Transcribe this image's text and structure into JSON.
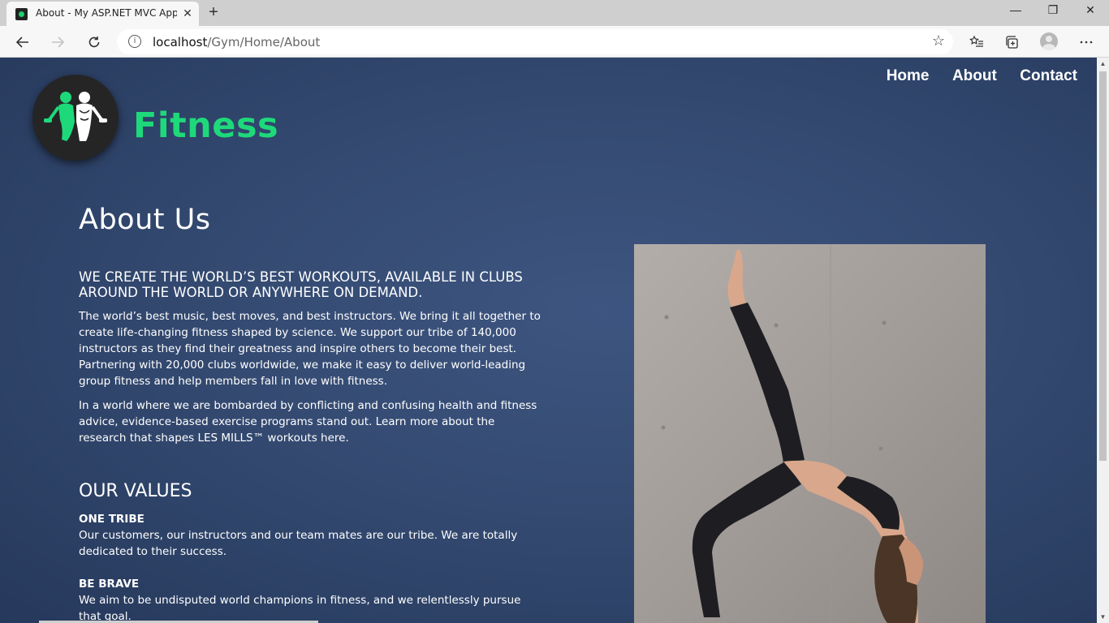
{
  "browser": {
    "tab_title": "About - My ASP.NET MVC Application",
    "tab_close": "✕",
    "new_tab": "+",
    "url_host": "localhost",
    "url_path": "/Gym/Home/About",
    "window_controls": {
      "minimize": "—",
      "restore": "❐",
      "close": "✕"
    },
    "icons": {
      "back": "back-arrow-icon",
      "forward": "forward-arrow-icon",
      "refresh": "refresh-icon",
      "info": "info-icon",
      "favorite": "star-icon",
      "favorites_bar": "favorites-icon",
      "collections": "collections-icon",
      "profile": "profile-avatar",
      "more": "ellipsis-icon"
    }
  },
  "site": {
    "brand": "Fitness",
    "brand_color": "#1ed97a",
    "nav": [
      "Home",
      "About",
      "Contact"
    ]
  },
  "main": {
    "heading": "About Us",
    "subheading": "WE CREATE THE WORLD’S BEST WORKOUTS, AVAILABLE IN CLUBS AROUND THE WORLD OR ANYWHERE ON DEMAND.",
    "paragraphs": [
      "The world’s best music, best moves, and best instructors. We bring it all together to create life-changing fitness shaped by science. We support our tribe of 140,000 instructors as they find their greatness and inspire others to become their best. Partnering with 20,000 clubs worldwide, we make it easy to deliver world-leading group fitness and help members fall in love with fitness.",
      "In a world where we are bombarded by conflicting and confusing health and fitness advice, evidence-based exercise programs stand out. Learn more about the research that shapes LES MILLS™ workouts here."
    ],
    "values_heading": "OUR VALUES",
    "values": [
      {
        "title": "ONE TRIBE",
        "text": "Our customers, our instructors and our team mates are our tribe. We are totally dedicated to their success."
      },
      {
        "title": "BE BRAVE",
        "text": "We aim to be undisputed world champions in fitness, and we relentlessly pursue that goal."
      }
    ]
  },
  "colors": {
    "page_bg": "#344a71",
    "text": "#ffffff"
  }
}
